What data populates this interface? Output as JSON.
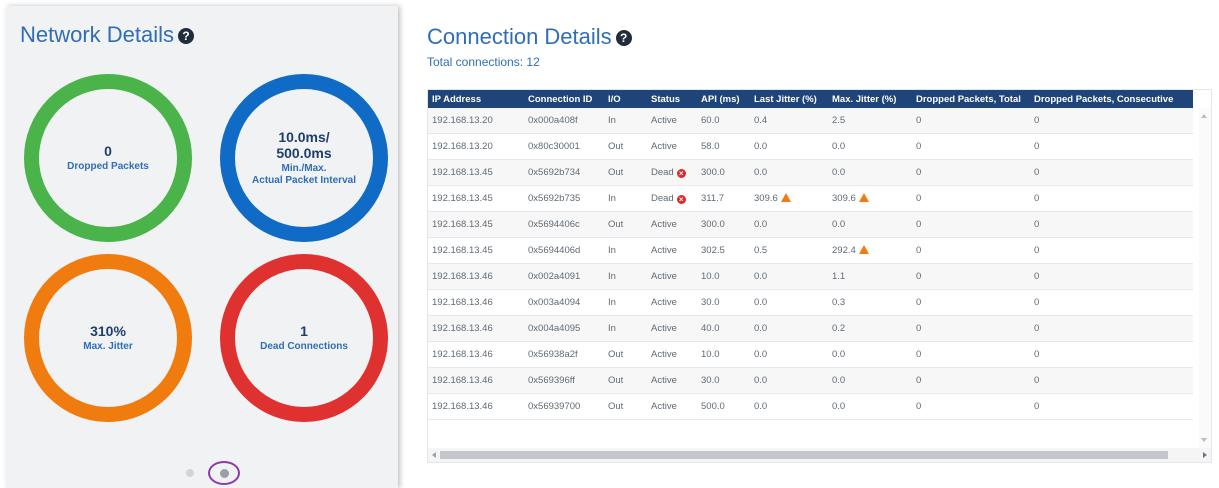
{
  "network": {
    "title": "Network Details",
    "help_icon": "?",
    "metrics": [
      {
        "value": "0",
        "label": "Dropped Packets",
        "color": "#4ab34a"
      },
      {
        "value_line1": "10.0ms/",
        "value_line2": "500.0ms",
        "label_line1": "Min./Max.",
        "label_line2": "Actual Packet Interval",
        "color": "#0f6bc6"
      },
      {
        "value": "310%",
        "label": "Max. Jitter",
        "color": "#f07c10"
      },
      {
        "value": "1",
        "label": "Dead Connections",
        "color": "#e03131"
      }
    ],
    "pager": {
      "pages": 2,
      "active": 2
    }
  },
  "connections": {
    "title": "Connection Details",
    "help_icon": "?",
    "subtitle": "Total connections: 12",
    "columns": [
      "IP Address",
      "Connection ID",
      "I/O",
      "Status",
      "API (ms)",
      "Last Jitter (%)",
      "Max. Jitter (%)",
      "Dropped Packets, Total",
      "Dropped Packets, Consecutive"
    ],
    "rows": [
      [
        "192.168.13.20",
        "0x000a408f",
        "In",
        "Active",
        "60.0",
        "0.4",
        "2.5",
        "0",
        "0"
      ],
      [
        "192.168.13.20",
        "0x80c30001",
        "Out",
        "Active",
        "58.0",
        "0.0",
        "0.0",
        "0",
        "0"
      ],
      [
        "192.168.13.45",
        "0x5692b734",
        "Out",
        "Dead",
        "300.0",
        "0.0",
        "0.0",
        "0",
        "0"
      ],
      [
        "192.168.13.45",
        "0x5692b735",
        "In",
        "Dead",
        "311.7",
        "309.6",
        "309.6",
        "0",
        "0"
      ],
      [
        "192.168.13.45",
        "0x5694406c",
        "Out",
        "Active",
        "300.0",
        "0.0",
        "0.0",
        "0",
        "0"
      ],
      [
        "192.168.13.45",
        "0x5694406d",
        "In",
        "Active",
        "302.5",
        "0.5",
        "292.4",
        "0",
        "0"
      ],
      [
        "192.168.13.46",
        "0x002a4091",
        "In",
        "Active",
        "10.0",
        "0.0",
        "1.1",
        "0",
        "0"
      ],
      [
        "192.168.13.46",
        "0x003a4094",
        "In",
        "Active",
        "30.0",
        "0.0",
        "0.3",
        "0",
        "0"
      ],
      [
        "192.168.13.46",
        "0x004a4095",
        "In",
        "Active",
        "40.0",
        "0.0",
        "0.2",
        "0",
        "0"
      ],
      [
        "192.168.13.46",
        "0x56938a2f",
        "Out",
        "Active",
        "10.0",
        "0.0",
        "0.0",
        "0",
        "0"
      ],
      [
        "192.168.13.46",
        "0x569396ff",
        "Out",
        "Active",
        "30.0",
        "0.0",
        "0.0",
        "0",
        "0"
      ],
      [
        "192.168.13.46",
        "0x56939700",
        "Out",
        "Active",
        "500.0",
        "0.0",
        "0.0",
        "0",
        "0"
      ]
    ],
    "status_icons": {
      "Dead": "dead-x-icon"
    },
    "warning_cells": [
      [
        3,
        5
      ],
      [
        3,
        6
      ],
      [
        5,
        6
      ]
    ]
  }
}
